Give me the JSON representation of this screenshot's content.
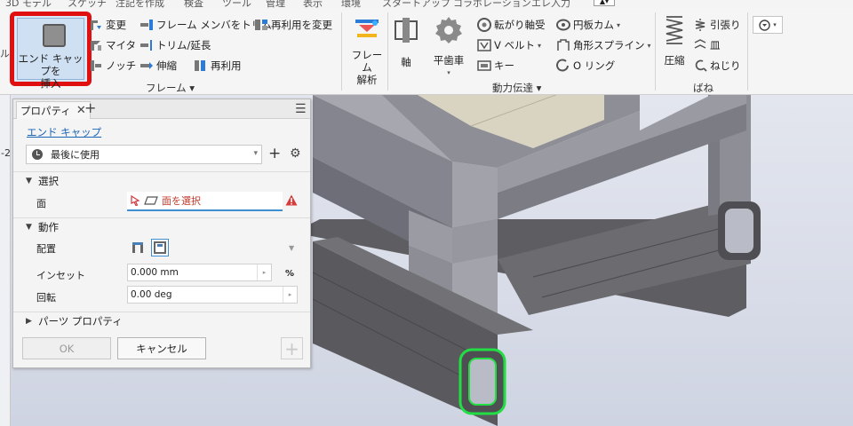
{
  "ribbon": {
    "tabs": [
      {
        "label": "3D モデル"
      },
      {
        "label": "スケッチ"
      },
      {
        "label": "注記を作成"
      },
      {
        "label": "検査"
      },
      {
        "label": "ツール"
      },
      {
        "label": "管理"
      },
      {
        "label": "表示"
      },
      {
        "label": "環境"
      },
      {
        "label": "スタートアップ"
      },
      {
        "label": "コラボレーション"
      },
      {
        "label": "エレ入力"
      }
    ],
    "frame_group": {
      "insert_end_cap": "エンド キャップを\n挿入",
      "change": "変更",
      "miter": "マイタ",
      "notch": "ノッチ",
      "trim_frame_member": "フレーム メンバをトリム",
      "trim_extend": "トリム/延長",
      "lengthen": "伸縮",
      "reuse": "再利用",
      "change_reuse": "再利用を変更",
      "label": "フレーム"
    },
    "frame_analysis": "フレーム\n解析",
    "power_group": {
      "shaft": "軸",
      "spur_gear": "平歯車",
      "bearing": "転がり軸受",
      "v_belt": "V ベルト",
      "key": "キー",
      "disc_cam": "円板カム",
      "spline": "角形スプライン",
      "o_ring": "O リング",
      "label": "動力伝達"
    },
    "spring_group": {
      "compression": "圧縮",
      "extension": "引張り",
      "belleville": "皿",
      "torsion": "ねじり",
      "label": "ばね"
    }
  },
  "panel": {
    "tab_label": "プロパティ",
    "command_link": "エンド キャップ",
    "preset_value": "最後に使用",
    "section_select": "選択",
    "face_label": "面",
    "face_placeholder": "面を選択",
    "section_action": "動作",
    "placement_label": "配置",
    "inset_label": "インセット",
    "inset_value": "0.000 mm",
    "inset_unit": "%",
    "rotation_label": "回転",
    "rotation_value": "0.00 deg",
    "section_part_props": "パーツ プロパティ",
    "ok_label": "OK",
    "cancel_label": "キャンセル"
  },
  "side_mark": "-2",
  "colors": {
    "highlight_red": "#e01010",
    "selection_green": "#22dd44",
    "link_blue": "#1a64b5",
    "focus_blue": "#3d8fd1"
  }
}
